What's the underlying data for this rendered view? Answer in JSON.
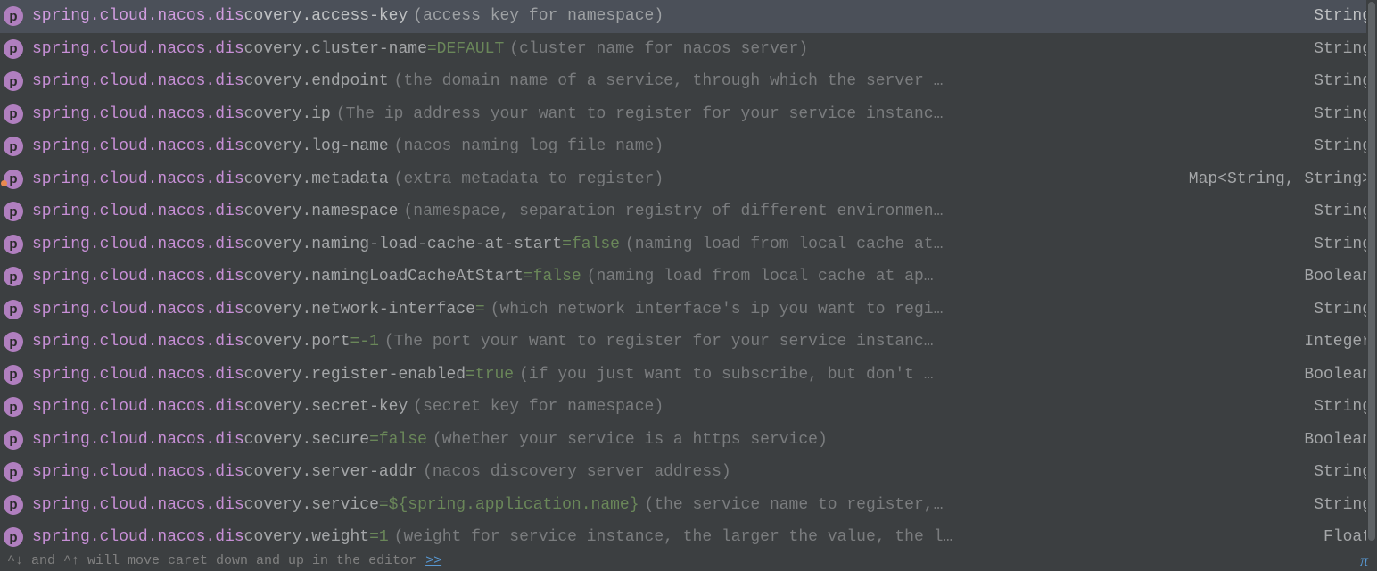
{
  "icon_glyph": "p",
  "items": [
    {
      "matched": "spring.cloud.nacos.dis",
      "rest": "covery.access-key",
      "default": "",
      "desc": "(access key for namespace)",
      "type": "String",
      "selected": true,
      "overlay": false
    },
    {
      "matched": "spring.cloud.nacos.dis",
      "rest": "covery.cluster-name",
      "default": "=DEFAULT",
      "desc": "(cluster name for nacos server)",
      "type": "String",
      "selected": false,
      "overlay": false
    },
    {
      "matched": "spring.cloud.nacos.dis",
      "rest": "covery.endpoint",
      "default": "",
      "desc": "(the domain name of a service, through which the server …",
      "type": "String",
      "selected": false,
      "overlay": false
    },
    {
      "matched": "spring.cloud.nacos.dis",
      "rest": "covery.ip",
      "default": "",
      "desc": "(The ip address your want to register for your service instanc…",
      "type": "String",
      "selected": false,
      "overlay": false
    },
    {
      "matched": "spring.cloud.nacos.dis",
      "rest": "covery.log-name",
      "default": "",
      "desc": "(nacos naming log file name)",
      "type": "String",
      "selected": false,
      "overlay": false
    },
    {
      "matched": "spring.cloud.nacos.dis",
      "rest": "covery.metadata",
      "default": "",
      "desc": "(extra metadata to register)",
      "type": "Map<String, String>",
      "selected": false,
      "overlay": true
    },
    {
      "matched": "spring.cloud.nacos.dis",
      "rest": "covery.namespace",
      "default": "",
      "desc": "(namespace, separation registry of different environmen…",
      "type": "String",
      "selected": false,
      "overlay": false
    },
    {
      "matched": "spring.cloud.nacos.dis",
      "rest": "covery.naming-load-cache-at-start",
      "default": "=false",
      "desc": "(naming load from local cache at…",
      "type": "String",
      "selected": false,
      "overlay": false
    },
    {
      "matched": "spring.cloud.nacos.dis",
      "rest": "covery.namingLoadCacheAtStart",
      "default": "=false",
      "desc": "(naming load from local cache at ap…",
      "type": "Boolean",
      "selected": false,
      "overlay": false
    },
    {
      "matched": "spring.cloud.nacos.dis",
      "rest": "covery.network-interface",
      "default": "=",
      "desc": "(which network interface's ip you want to regi…",
      "type": "String",
      "selected": false,
      "overlay": false
    },
    {
      "matched": "spring.cloud.nacos.dis",
      "rest": "covery.port",
      "default": "=-1",
      "desc": "(The port your want to register for your service instanc…",
      "type": "Integer",
      "selected": false,
      "overlay": false
    },
    {
      "matched": "spring.cloud.nacos.dis",
      "rest": "covery.register-enabled",
      "default": "=true",
      "desc": "(if you just want to subscribe, but don't …",
      "type": "Boolean",
      "selected": false,
      "overlay": false
    },
    {
      "matched": "spring.cloud.nacos.dis",
      "rest": "covery.secret-key",
      "default": "",
      "desc": "(secret key for namespace)",
      "type": "String",
      "selected": false,
      "overlay": false
    },
    {
      "matched": "spring.cloud.nacos.dis",
      "rest": "covery.secure",
      "default": "=false",
      "desc": "(whether your service is a https service)",
      "type": "Boolean",
      "selected": false,
      "overlay": false
    },
    {
      "matched": "spring.cloud.nacos.dis",
      "rest": "covery.server-addr",
      "default": "",
      "desc": "(nacos discovery server address)",
      "type": "String",
      "selected": false,
      "overlay": false
    },
    {
      "matched": "spring.cloud.nacos.dis",
      "rest": "covery.service",
      "default": "=${spring.application.name}",
      "desc": "(the service name to register,…",
      "type": "String",
      "selected": false,
      "overlay": false
    },
    {
      "matched": "spring.cloud.nacos.dis",
      "rest": "covery.weight",
      "default": "=1",
      "desc": "(weight for service instance, the larger the value, the l…",
      "type": "Float",
      "selected": false,
      "overlay": false
    }
  ],
  "hint": {
    "text": "^↓ and ^↑ will move caret down and up in the editor",
    "link": ">>",
    "pi": "π"
  }
}
